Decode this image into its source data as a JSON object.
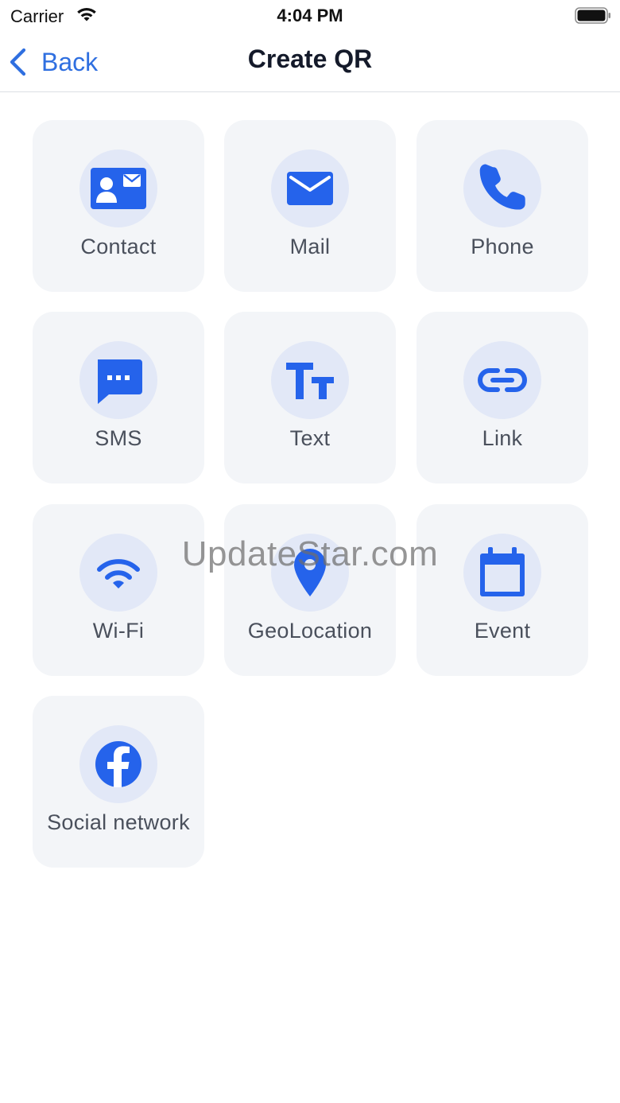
{
  "status_bar": {
    "carrier": "Carrier",
    "time": "4:04 PM"
  },
  "nav": {
    "back_label": "Back",
    "title": "Create QR"
  },
  "tiles": [
    {
      "label": "Contact",
      "icon": "contact-card-icon"
    },
    {
      "label": "Mail",
      "icon": "mail-icon"
    },
    {
      "label": "Phone",
      "icon": "phone-icon"
    },
    {
      "label": "SMS",
      "icon": "sms-icon"
    },
    {
      "label": "Text",
      "icon": "text-icon"
    },
    {
      "label": "Link",
      "icon": "link-icon"
    },
    {
      "label": "Wi-Fi",
      "icon": "wifi-icon"
    },
    {
      "label": "GeoLocation",
      "icon": "location-pin-icon"
    },
    {
      "label": "Event",
      "icon": "calendar-icon"
    },
    {
      "label": "Social network",
      "icon": "facebook-icon"
    }
  ],
  "watermark": "UpdateStar.com",
  "colors": {
    "accent": "#2563eb",
    "back_link": "#2f6fe0",
    "tile_bg": "#f3f5f8",
    "icon_circle_bg": "#e2e8f7",
    "label_text": "#4a505c"
  }
}
